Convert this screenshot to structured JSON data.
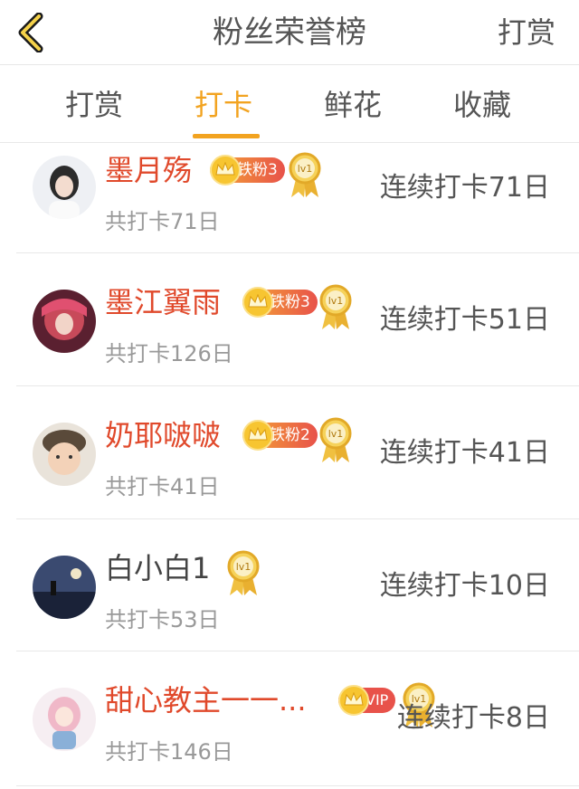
{
  "header": {
    "title": "粉丝荣誉榜",
    "reward_label": "打赏"
  },
  "tabs": [
    {
      "label": "打赏"
    },
    {
      "label": "打卡"
    },
    {
      "label": "鲜花"
    },
    {
      "label": "收藏"
    }
  ],
  "active_tab": "打卡",
  "accent_color": "#f2a320",
  "name_color": "#e0492b",
  "rows": [
    {
      "name": "墨月殇",
      "badge": "铁粉3",
      "level": "lv1",
      "total": "共打卡71日",
      "streak": "连续打卡71日"
    },
    {
      "name": "墨江翼雨",
      "badge": "铁粉3",
      "level": "lv1",
      "total": "共打卡126日",
      "streak": "连续打卡51日"
    },
    {
      "name": "奶耶啵啵",
      "badge": "铁粉2",
      "level": "lv1",
      "total": "共打卡41日",
      "streak": "连续打卡41日"
    },
    {
      "name": "白小白1",
      "badge": "",
      "level": "lv1",
      "total": "共打卡53日",
      "streak": "连续打卡10日"
    },
    {
      "name": "甜心教主一一...",
      "badge": "VIP",
      "level": "lv1",
      "total": "共打卡146日",
      "streak": "连续打卡8日"
    }
  ]
}
